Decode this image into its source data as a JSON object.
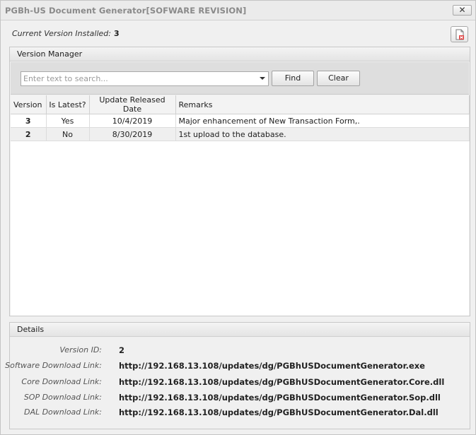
{
  "window": {
    "title": "PGBh-US Document Generator[SOFWARE REVISION]",
    "close_glyph": "✕"
  },
  "header": {
    "current_version_label": "Current Version Installed:",
    "current_version_value": "3",
    "action_icon": "document-delete-icon"
  },
  "version_manager": {
    "title": "Version Manager",
    "search": {
      "placeholder": "Enter text to search...",
      "value": ""
    },
    "find_label": "Find",
    "clear_label": "Clear",
    "columns": [
      "Version",
      "Is Latest?",
      "Update Released Date",
      "Remarks"
    ],
    "rows": [
      {
        "version": "3",
        "is_latest": "Yes",
        "date": "10/4/2019",
        "remarks": "Major enhancement of New Transaction Form,."
      },
      {
        "version": "2",
        "is_latest": "No",
        "date": "8/30/2019",
        "remarks": "1st upload to the database."
      }
    ]
  },
  "details": {
    "title": "Details",
    "fields": [
      {
        "label": "Version ID:",
        "value": "2"
      },
      {
        "label": "Software Download Link:",
        "value": "http://192.168.13.108/updates/dg/PGBhUSDocumentGenerator.exe"
      },
      {
        "label": "Core Download Link:",
        "value": "http://192.168.13.108/updates/dg/PGBhUSDocumentGenerator.Core.dll"
      },
      {
        "label": "SOP Download Link:",
        "value": "http://192.168.13.108/updates/dg/PGBhUSDocumentGenerator.Sop.dll"
      },
      {
        "label": "DAL Download Link:",
        "value": "http://192.168.13.108/updates/dg/PGBhUSDocumentGenerator.Dal.dll"
      }
    ]
  }
}
